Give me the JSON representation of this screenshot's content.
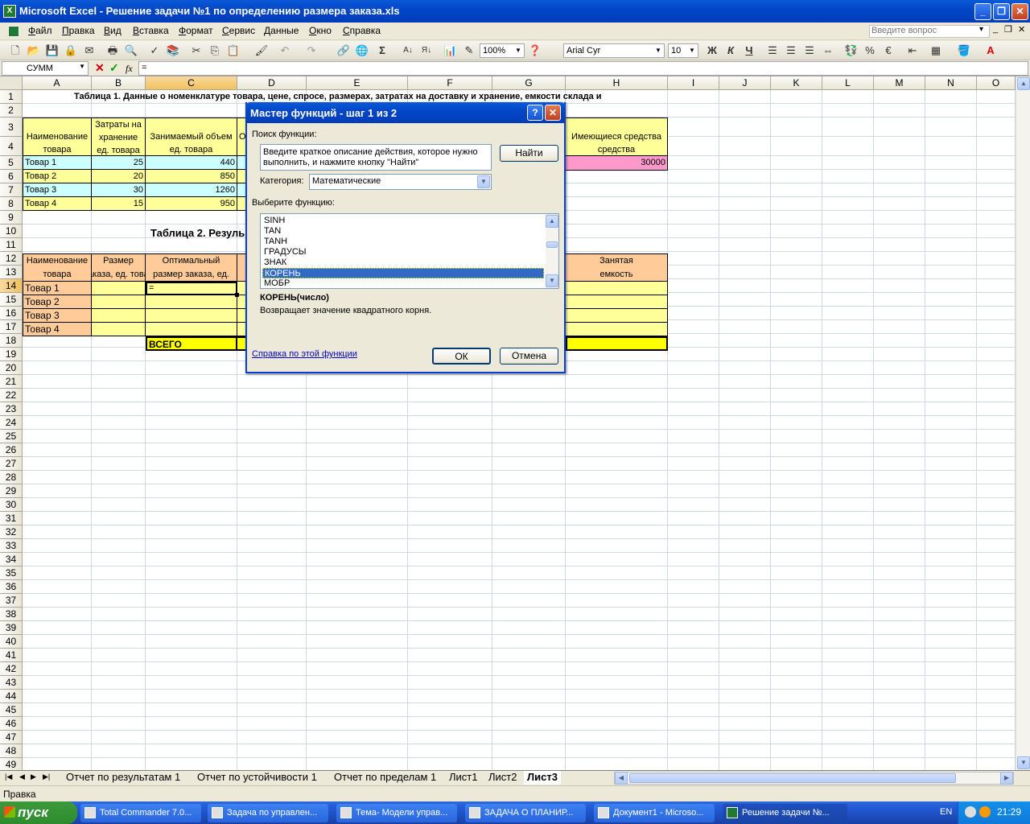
{
  "window": {
    "title": "Microsoft Excel - Решение задачи №1 по определению размера заказа.xls",
    "app_icon": "X"
  },
  "menu": [
    "Файл",
    "Правка",
    "Вид",
    "Вставка",
    "Формат",
    "Сервис",
    "Данные",
    "Окно",
    "Справка"
  ],
  "question_placeholder": "Введите вопрос",
  "toolbar": {
    "zoom": "100%",
    "font": "Arial Cyr",
    "size": "10",
    "bold": "Ж",
    "italic": "К",
    "underline": "Ч",
    "percent": "%",
    "euro": "€"
  },
  "formula_bar": {
    "name_box": "СУММ",
    "fx": "fx",
    "formula": "="
  },
  "columns": [
    "A",
    "B",
    "C",
    "D",
    "E",
    "F",
    "G",
    "H",
    "I",
    "J",
    "K",
    "L",
    "M",
    "N",
    "O"
  ],
  "rows": [
    "1",
    "2",
    "3",
    "4",
    "5",
    "6",
    "7",
    "8",
    "9",
    "10",
    "11",
    "12",
    "13",
    "14",
    "15",
    "16",
    "17",
    "18",
    "19",
    "20",
    "21",
    "22",
    "23",
    "24",
    "25",
    "26",
    "27",
    "28",
    "29",
    "30",
    "31",
    "32",
    "33",
    "34",
    "35",
    "36",
    "37",
    "38",
    "39",
    "40",
    "41",
    "42",
    "43",
    "44",
    "45",
    "46",
    "47",
    "48",
    "49"
  ],
  "sheet": {
    "table1_title": "Таблица 1. Данные о номенклатуре товара, цене, спросе, размерах, затратах на доставку и хранение, емкости склада и",
    "t1_headers": {
      "a1": "Наименование",
      "a2": "товара",
      "b0": "Затраты на",
      "b1": "хранение",
      "b2": "ед. товара",
      "c1": "Занимаемый объем",
      "c2": "ед. товара",
      "d": "О",
      "h1": "Имеющиеся средства",
      "h2": "средства"
    },
    "t1_rows": [
      {
        "name": "Товар 1",
        "b": "25",
        "c": "440"
      },
      {
        "name": "Товар 2",
        "b": "20",
        "c": "850"
      },
      {
        "name": "Товар 3",
        "b": "30",
        "c": "1260"
      },
      {
        "name": "Товар 4",
        "b": "15",
        "c": "950"
      }
    ],
    "h5": "30000",
    "table2_title": "Таблица 2. Резуль",
    "t2_headers": {
      "a1": "Наименование",
      "a2": "товара",
      "b1": "Размер",
      "b2": "заказа, ед. товара",
      "c1": "Оптимальный",
      "c2": "размер заказа, ед.",
      "h1": "Занятая",
      "h2": "емкость"
    },
    "t2_rows": [
      "Товар 1",
      "Товар 2",
      "Товар 3",
      "Товар 4"
    ],
    "c14": "=",
    "total": "ВСЕГО"
  },
  "dialog": {
    "title": "Мастер функций - шаг 1 из 2",
    "search_label": "Поиск функции:",
    "search_text": "Введите краткое описание действия, которое нужно выполнить, и нажмите кнопку \"Найти\"",
    "find_button": "Найти",
    "category_label": "Категория:",
    "category_value": "Математические",
    "select_label": "Выберите функцию:",
    "functions": [
      "SINH",
      "TAN",
      "TANH",
      "ГРАДУСЫ",
      "ЗНАК",
      "КОРЕНЬ",
      "МОБР"
    ],
    "selected_function": "КОРЕНЬ",
    "signature": "КОРЕНЬ(число)",
    "description": "Возвращает значение квадратного корня.",
    "help_link": "Справка по этой функции",
    "ok": "ОК",
    "cancel": "Отмена"
  },
  "sheet_tabs": [
    "Отчет по результатам 1",
    "Отчет по устойчивости 1",
    "Отчет по пределам 1",
    "Лист1",
    "Лист2",
    "Лист3"
  ],
  "active_tab": "Лист3",
  "status": "Правка",
  "taskbar": {
    "start": "пуск",
    "tasks": [
      "Total Commander 7.0...",
      "Задача по управлен...",
      "Тема- Модели управ...",
      "ЗАДАЧА О ПЛАНИР...",
      "Документ1 - Microso...",
      "Решение задачи №..."
    ],
    "lang": "EN",
    "clock": "21:29"
  },
  "colors": {
    "cyan": "#ccffff",
    "yellow": "#ffff99",
    "pink": "#ff99cc",
    "orange": "#ffcc99",
    "bright_yellow": "#ffff00",
    "selection": "#316ac5"
  }
}
